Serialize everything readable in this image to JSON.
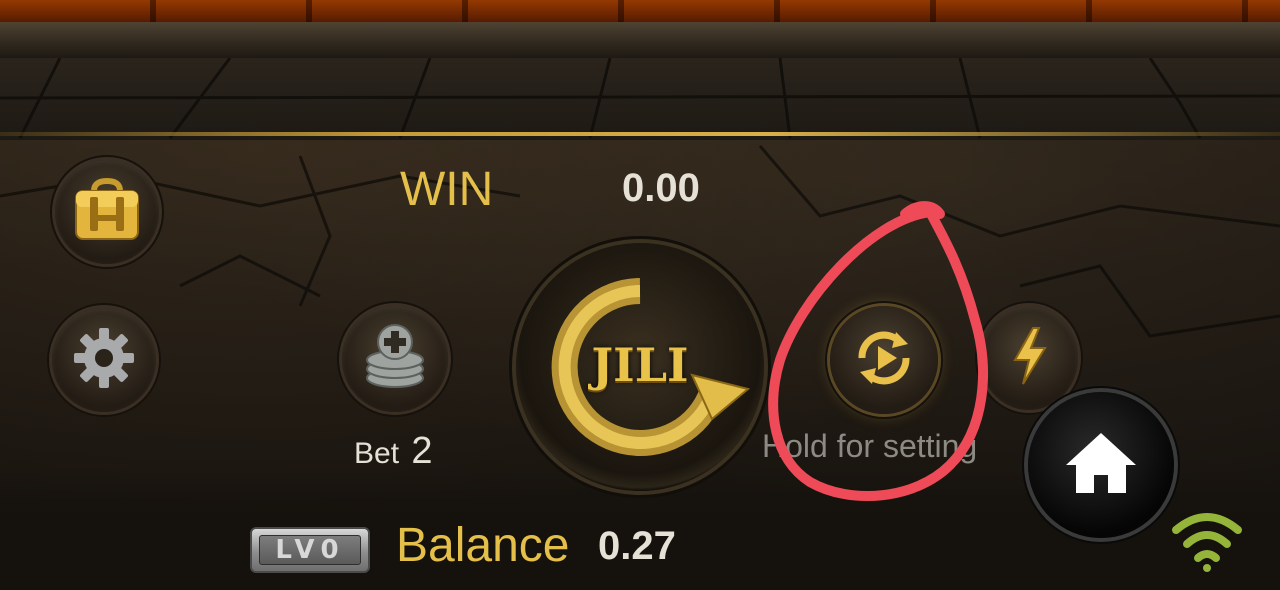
{
  "win": {
    "label": "WIN",
    "value": "0.00"
  },
  "bet": {
    "label": "Bet",
    "value": "2"
  },
  "spin": {
    "brand": "JILI"
  },
  "auto_spin": {
    "hint": "Hold for setting"
  },
  "balance": {
    "label": "Balance",
    "value": "0.27"
  },
  "level": {
    "text": "LV0"
  },
  "status": {
    "network": "wifi-icon"
  },
  "icons": {
    "bag": "briefcase-icon",
    "settings": "gear-icon",
    "bet": "coin-stack-plus-icon",
    "auto": "auto-spin-icon",
    "turbo": "lightning-icon",
    "home": "home-icon"
  },
  "colors": {
    "gold": "#e4bf4a",
    "annotation": "#ee4a58",
    "text": "#e6e1d6"
  }
}
